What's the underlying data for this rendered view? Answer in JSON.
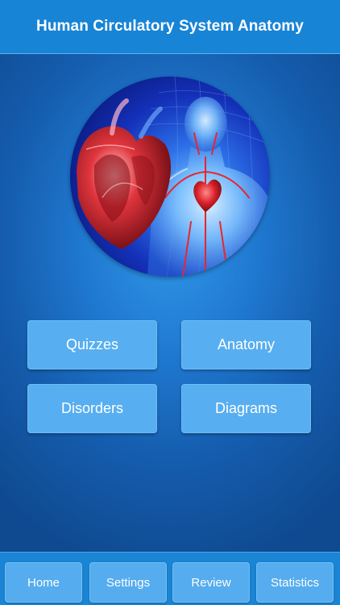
{
  "header": {
    "title": "Human Circulatory System Anatomy"
  },
  "hero": {
    "icon": "heart-anatomy-illustration"
  },
  "menu": {
    "quizzes": "Quizzes",
    "anatomy": "Anatomy",
    "disorders": "Disorders",
    "diagrams": "Diagrams"
  },
  "tabbar": {
    "home": "Home",
    "settings": "Settings",
    "review": "Review",
    "statistics": "Statistics"
  },
  "colors": {
    "header_bg": "#1784d6",
    "button_bg": "#57aef0",
    "background_center": "#2f97e8",
    "background_edge": "#0f4a91"
  }
}
